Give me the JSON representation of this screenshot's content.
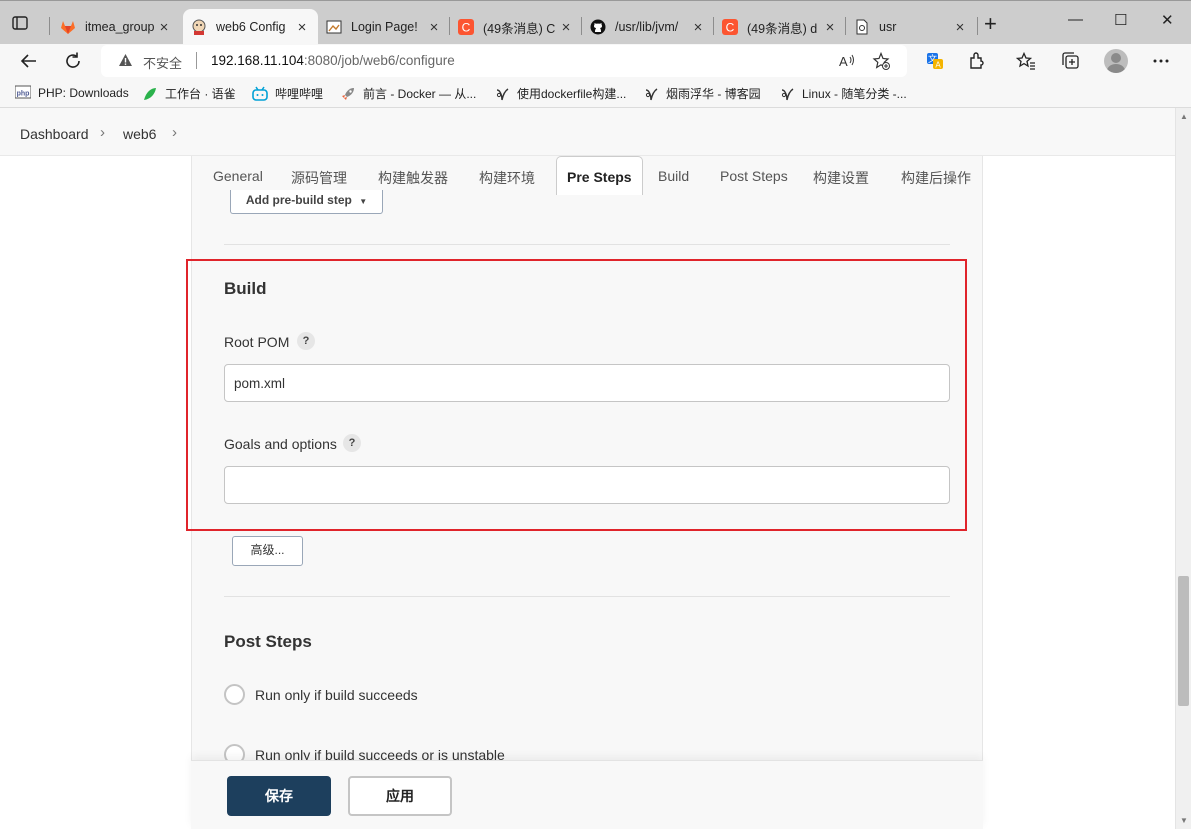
{
  "browser": {
    "tabs": [
      {
        "title": "itmea_group",
        "close": "×",
        "favicon": "gitlab-icon",
        "color": "#fc6d26"
      },
      {
        "title": "web6 Config",
        "close": "×",
        "favicon": "jenkins-icon",
        "color": "#d33833",
        "active": true
      },
      {
        "title": "Login Page!",
        "close": "×",
        "favicon": "image-icon",
        "color": "#888888"
      },
      {
        "title": "(49条消息) C",
        "close": "×",
        "favicon": "csdn-icon",
        "color": "#fc5531"
      },
      {
        "title": "/usr/lib/jvm/",
        "close": "×",
        "favicon": "github-icon",
        "color": "#111111"
      },
      {
        "title": "(49条消息) d",
        "close": "×",
        "favicon": "csdn-icon",
        "color": "#fc5531"
      },
      {
        "title": "usr",
        "close": "×",
        "favicon": "file-icon",
        "color": "#333333"
      }
    ],
    "new_tab": "+",
    "window_controls": {
      "minimize": "—",
      "maximize": "☐",
      "close": "✕"
    },
    "address": {
      "security_label": "不安全",
      "host": "192.168.11.104",
      "path": ":8080/job/web6/configure"
    },
    "bookmarks": [
      {
        "label": "PHP: Downloads",
        "icon": "php-icon"
      },
      {
        "label": "工作台 · 语雀",
        "icon": "yuque-icon"
      },
      {
        "label": "哔哩哔哩",
        "icon": "bilibili-icon"
      },
      {
        "label": "前言 - Docker — 从...",
        "icon": "rocket-icon"
      },
      {
        "label": "使用dockerfile构建...",
        "icon": "cnblogs-icon"
      },
      {
        "label": "烟雨浮华 - 博客园",
        "icon": "cnblogs-icon"
      },
      {
        "label": "Linux - 随笔分类 -...",
        "icon": "cnblogs-icon"
      }
    ]
  },
  "breadcrumbs": [
    {
      "label": "Dashboard"
    },
    {
      "label": "web6"
    }
  ],
  "config_tabs": [
    "General",
    "源码管理",
    "构建触发器",
    "构建环境",
    "Pre Steps",
    "Build",
    "Post Steps",
    "构建设置",
    "构建后操作"
  ],
  "active_tab": "Pre Steps",
  "pre_steps": {
    "add_button": "Add pre-build step"
  },
  "build": {
    "title": "Build",
    "root_pom_label": "Root POM",
    "root_pom_value": "pom.xml",
    "goals_label": "Goals and options",
    "goals_value": "",
    "help": "?",
    "advanced_button": "高级..."
  },
  "post_steps": {
    "title": "Post Steps",
    "options": [
      "Run only if build succeeds",
      "Run only if build succeeds or is unstable"
    ]
  },
  "actions": {
    "save": "保存",
    "apply": "应用"
  },
  "colors": {
    "highlight": "#e0242b",
    "save_bg": "#1d3f5d"
  }
}
